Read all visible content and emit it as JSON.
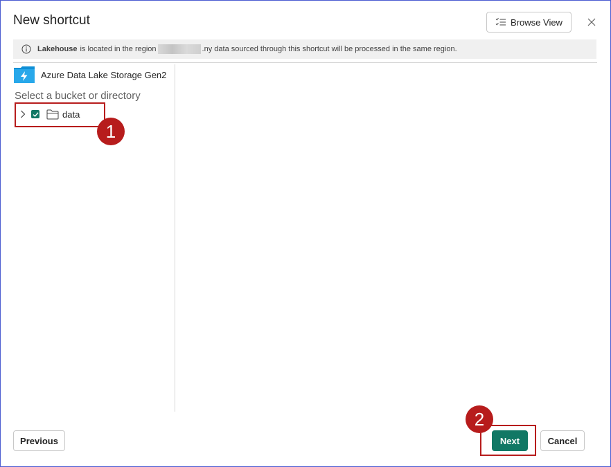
{
  "dialog": {
    "title": "New shortcut",
    "browse_view_label": "Browse View"
  },
  "banner": {
    "bold_text": "Lakehouse",
    "text_before_redaction": "is located in the region",
    "text_after_redaction": ".ny data sourced through this shortcut will be processed in the same region."
  },
  "source": {
    "name": "Azure Data Lake Storage Gen2"
  },
  "tree": {
    "section_label": "Select a bucket or directory",
    "items": [
      {
        "label": "data",
        "checked": true
      }
    ]
  },
  "annotations": {
    "badge_1": "1",
    "badge_2": "2",
    "highlight_color": "#b71c1c"
  },
  "footer": {
    "previous_label": "Previous",
    "next_label": "Next",
    "cancel_label": "Cancel"
  },
  "colors": {
    "accent": "#117865",
    "dialog_border": "#4a5bd1"
  },
  "icons": {
    "browse": "checklist-icon",
    "close": "close-icon",
    "info": "info-icon",
    "source": "azure-data-lake-icon",
    "expand": "chevron-right-icon",
    "folder": "folder-icon"
  }
}
